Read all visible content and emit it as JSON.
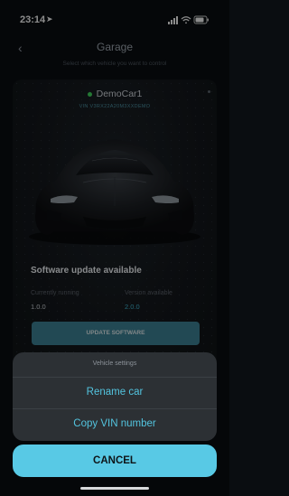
{
  "status_bar": {
    "time": "23:14",
    "location_icon": "location-arrow-icon",
    "signal_icon": "cellular-signal-icon",
    "wifi_icon": "wifi-icon",
    "battery_icon": "battery-icon"
  },
  "header": {
    "back_icon": "chevron-left-icon",
    "title": "Garage",
    "subtitle": "Select which vehicle you want to control"
  },
  "vehicle": {
    "name": "DemoCar1",
    "status_color": "#3fcf5a",
    "vin": "VIN V3RX22A20M3XXDEMO"
  },
  "software_update": {
    "title": "Software update available",
    "running_label": "Currently running",
    "running_value": "1.0.0",
    "available_label": "Version available",
    "available_value": "2.0.0",
    "button_label": "UPDATE SOFTWARE"
  },
  "action_sheet": {
    "title": "Vehicle settings",
    "items": [
      {
        "label": "Rename car"
      },
      {
        "label": "Copy VIN number"
      }
    ],
    "cancel_label": "CANCEL"
  },
  "colors": {
    "accent": "#58c9e5",
    "background": "#0a0d11",
    "sheet": "#2c3034"
  }
}
